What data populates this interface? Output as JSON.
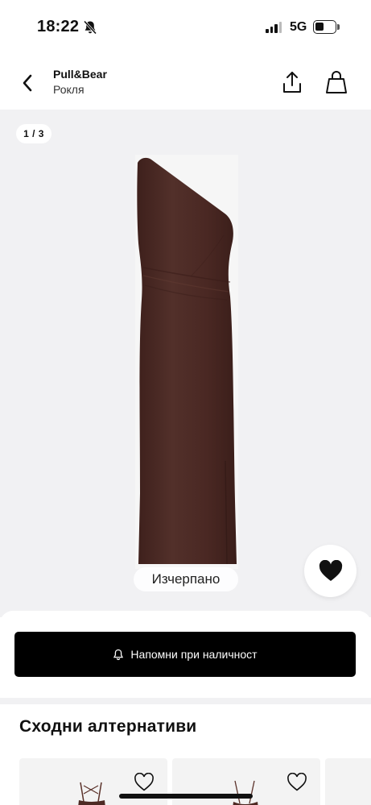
{
  "status_bar": {
    "time": "18:22",
    "network": "5G",
    "icons": [
      "bell-off-icon",
      "signal-icon",
      "battery-icon"
    ]
  },
  "header": {
    "brand": "Pull&Bear",
    "category": "Рокля",
    "icons": [
      "back-chevron-icon",
      "share-icon",
      "shopping-bag-icon"
    ]
  },
  "gallery": {
    "counter": "1 / 3",
    "status_label": "Изчерпано",
    "dress_color": "#4a2823",
    "background_color": "#f1f1f3",
    "favorite_icon": "heart-icon"
  },
  "notify": {
    "label": "Напомни при наличност",
    "icon": "bell-icon"
  },
  "similar": {
    "title": "Сходни алтернативи",
    "cards": [
      {
        "favorite_icon": "heart-outline-icon"
      },
      {
        "favorite_icon": "heart-outline-icon"
      }
    ]
  }
}
